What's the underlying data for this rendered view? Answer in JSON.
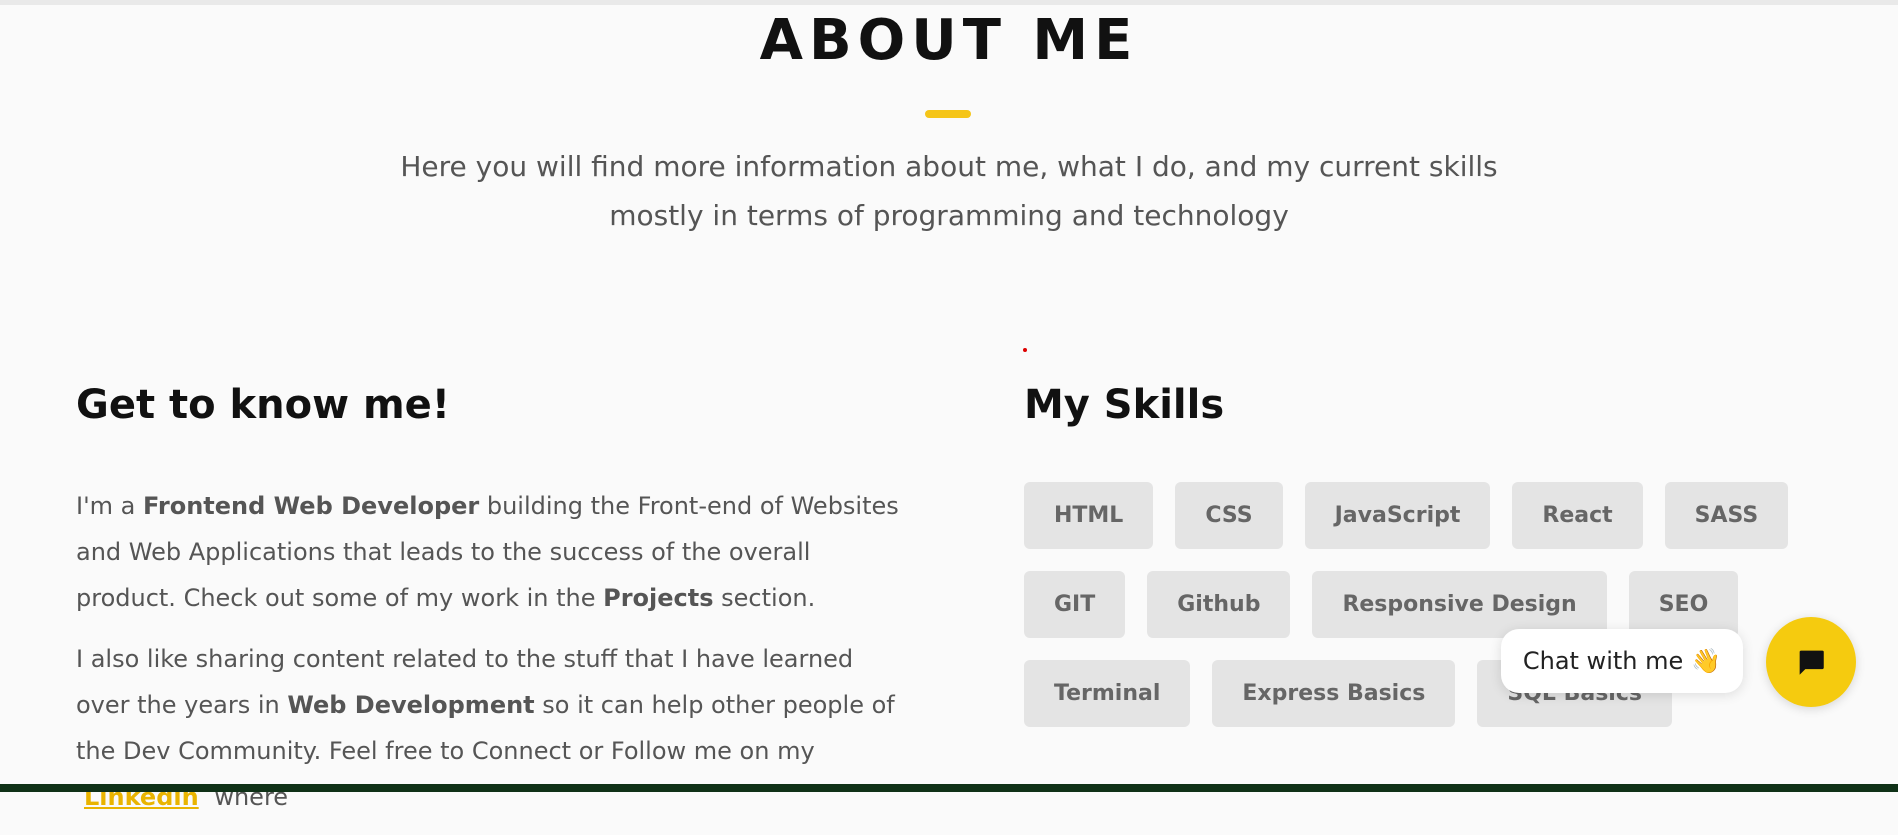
{
  "about": {
    "title": "ABOUT ME",
    "subtitle": "Here you will find more information about me, what I do, and my current skills mostly in terms of programming and technology"
  },
  "get_to_know": {
    "heading": "Get to know me!",
    "p1_a": "I'm a ",
    "p1_b": "Frontend Web Developer",
    "p1_c": " building the Front-end of Websites and Web Applications that leads to the success of the overall product. Check out some of my work in the ",
    "p1_d": "Projects",
    "p1_e": " section.",
    "p2_a": "I also like sharing content related to the stuff that I have learned over the years in ",
    "p2_b": "Web Development",
    "p2_c": " so it can help other people of the Dev Community. Feel free to Connect or Follow me on my ",
    "p2_link": "Linkedin",
    "p2_d": " where"
  },
  "skills": {
    "heading": "My Skills",
    "rows": [
      [
        "HTML",
        "CSS",
        "JavaScript",
        "React",
        "SASS"
      ],
      [
        "GIT",
        "Github",
        "Responsive Design",
        "SEO"
      ],
      [
        "Terminal",
        "Express Basics",
        "SQL Basics"
      ]
    ]
  },
  "chat": {
    "label": "Chat with me",
    "wave": "👋",
    "icon": "chat-bubble-icon"
  },
  "colors": {
    "accent": "#f5c518",
    "background": "#fafafa",
    "footer": "#0f3117"
  }
}
